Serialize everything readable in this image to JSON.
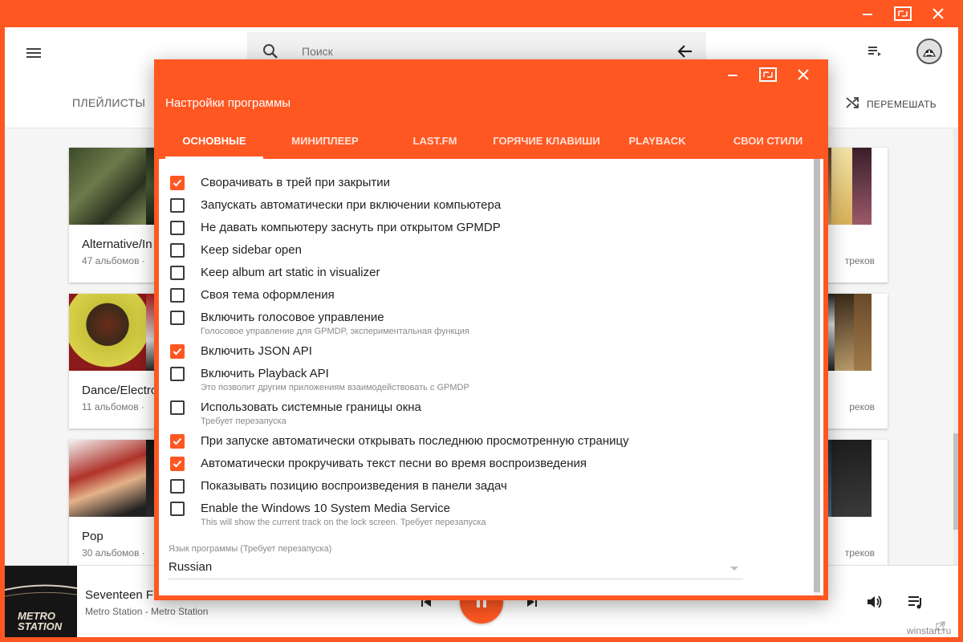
{
  "colors": {
    "accent": "#ff5722",
    "text": "#212121",
    "hint": "#8a8a8a"
  },
  "search": {
    "placeholder": "Поиск"
  },
  "nav": {
    "playlists": "ПЛЕЙЛИСТЫ",
    "shuffle": "ПЕРЕМЕШАТЬ"
  },
  "cards_left": [
    {
      "title": "Alternative/In",
      "sub": "47 альбомов ·"
    },
    {
      "title": "Dance/Electro",
      "sub": "11 альбомов ·"
    },
    {
      "title": "Pop",
      "sub": "30 альбомов ·"
    }
  ],
  "cards_right": [
    {
      "sub": "треков"
    },
    {
      "sub": "реков"
    },
    {
      "sub": "треков"
    }
  ],
  "player": {
    "title": "Seventeen F",
    "artist": "Metro Station - Metro Station",
    "album_art_text": "METRO STATION"
  },
  "watermark": "winstart.ru",
  "dialog": {
    "title": "Настройки программы",
    "tabs": [
      {
        "label": "ОСНОВНЫЕ",
        "active": true
      },
      {
        "label": "МИНИПЛЕЕР"
      },
      {
        "label": "LAST.FM"
      },
      {
        "label": "ГОРЯЧИЕ КЛАВИШИ"
      },
      {
        "label": "PLAYBACK"
      },
      {
        "label": "СВОИ СТИЛИ"
      }
    ],
    "options": [
      {
        "label": "Сворачивать в трей при закрытии",
        "checked": true
      },
      {
        "label": "Запускать автоматически при включении компьютера",
        "checked": false
      },
      {
        "label": "Не давать компьютеру заснуть при открытом GPMDP",
        "checked": false
      },
      {
        "label": "Keep sidebar open",
        "checked": false
      },
      {
        "label": "Keep album art static in visualizer",
        "checked": false
      },
      {
        "label": "Своя тема оформления",
        "checked": false
      },
      {
        "label": "Включить голосовое управление",
        "hint": "Голосовое управление для GPMDP, экспериментальная функция",
        "checked": false
      },
      {
        "label": "Включить JSON API",
        "checked": true
      },
      {
        "label": "Включить Playback API",
        "hint": "Это позволит другим приложениям взаимодействовать с GPMDP",
        "checked": false
      },
      {
        "label": "Использовать системные границы окна",
        "hint": "Требует перезапуска",
        "checked": false
      },
      {
        "label": "При запуске автоматически открывать последнюю просмотренную страницу",
        "checked": true
      },
      {
        "label": "Автоматически прокручивать текст песни во время воспроизведения",
        "checked": true
      },
      {
        "label": "Показывать позицию воспроизведения в панели задач",
        "checked": false
      },
      {
        "label": "Enable the Windows 10 System Media Service",
        "hint": "This will show the current track on the lock screen. Требует перезапуска",
        "checked": false
      }
    ],
    "language": {
      "caption": "Язык программы (Требует перезапуска)",
      "value": "Russian"
    }
  }
}
